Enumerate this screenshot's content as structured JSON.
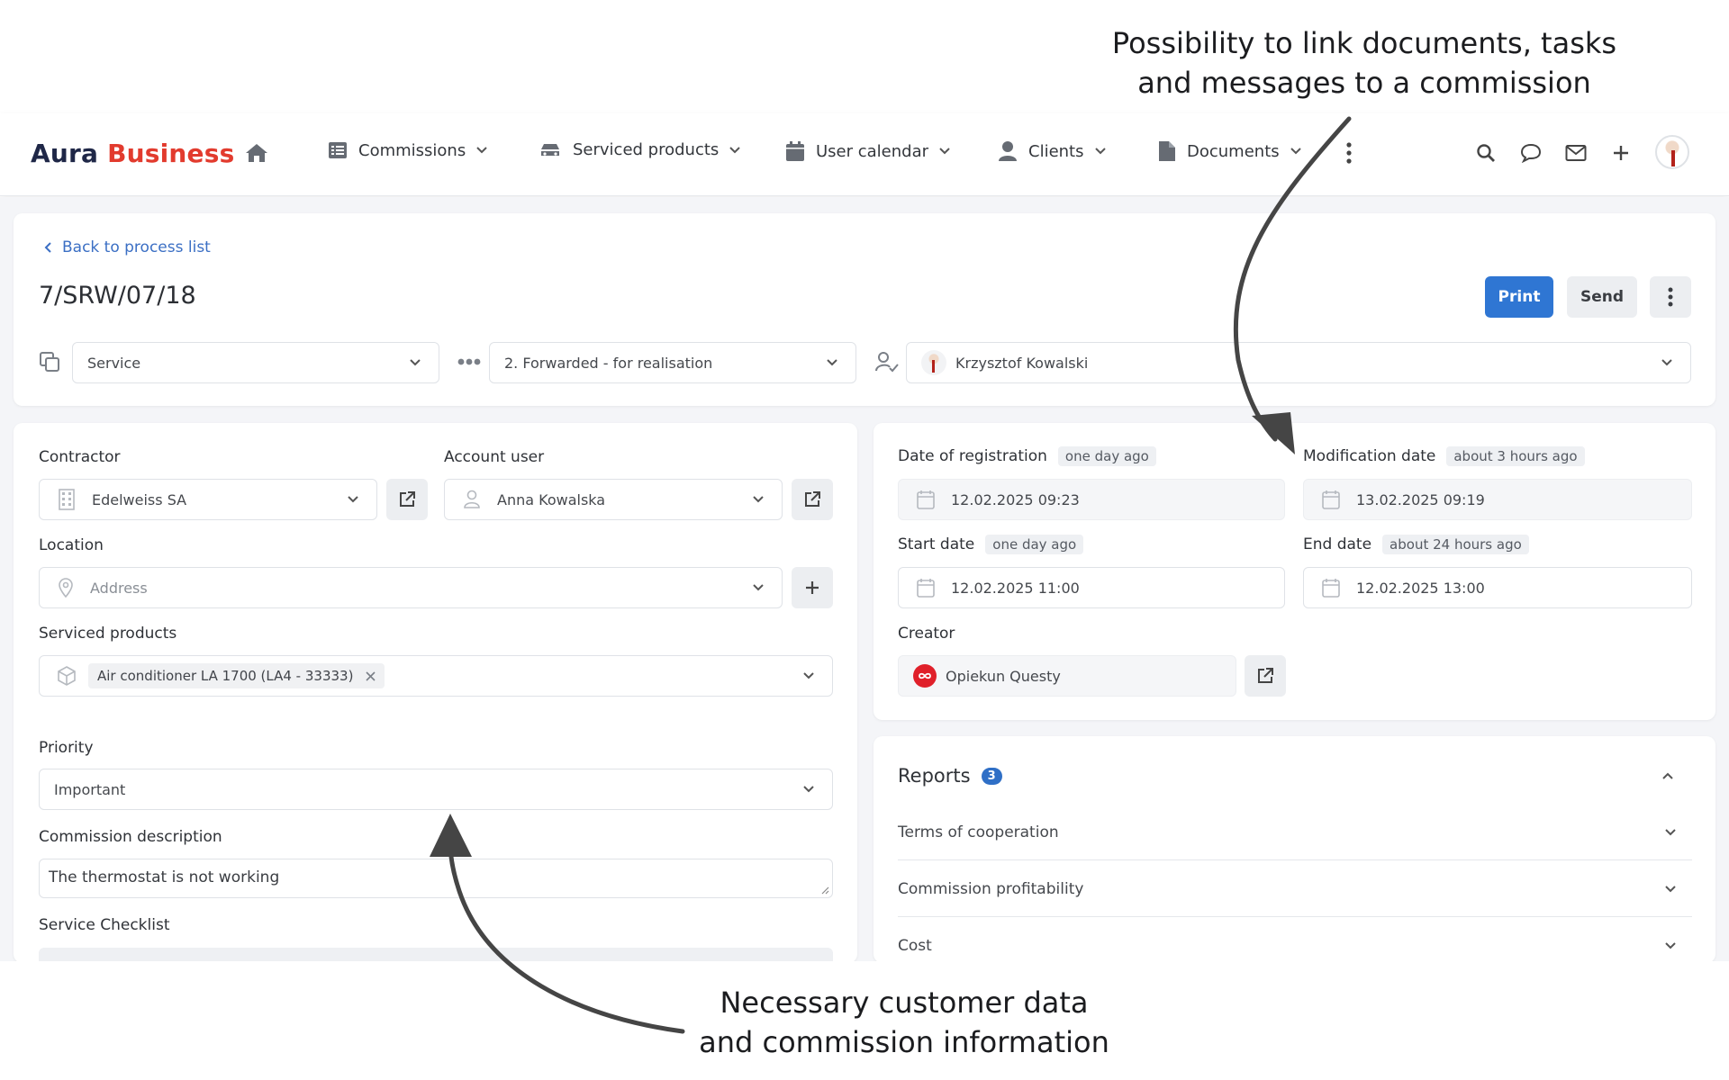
{
  "annotations": {
    "top_line1": "Possibility to link documents, tasks",
    "top_line2": "and messages to a commission",
    "bottom_line1": "Necessary customer data",
    "bottom_line2": "and commission information"
  },
  "navbar": {
    "logo_part1": "Aura",
    "logo_part2": "Business",
    "items": [
      {
        "label": "Commissions",
        "icon": "list-icon"
      },
      {
        "label": "Serviced products",
        "icon": "car-icon"
      },
      {
        "label": "User calendar",
        "icon": "calendar-icon"
      },
      {
        "label": "Clients",
        "icon": "user-icon"
      },
      {
        "label": "Documents",
        "icon": "document-icon"
      }
    ]
  },
  "header": {
    "back_label": "Back to process list",
    "title": "7/SRW/07/18",
    "print_label": "Print",
    "send_label": "Send",
    "type_value": "Service",
    "status_value": "2. Forwarded - for realisation",
    "assignee_value": "Krzysztof Kowalski"
  },
  "left": {
    "contractor_label": "Contractor",
    "contractor_value": "Edelweiss SA",
    "account_user_label": "Account user",
    "account_user_value": "Anna Kowalska",
    "location_label": "Location",
    "location_placeholder": "Address",
    "serviced_products_label": "Serviced products",
    "serviced_product_chip": "Air conditioner LA 1700 (LA4 - 33333)",
    "priority_label": "Priority",
    "priority_value": "Important",
    "description_label": "Commission description",
    "description_value": "The thermostat is not working",
    "checklist_label": "Service Checklist"
  },
  "dates": {
    "registration_label": "Date of registration",
    "registration_rel": "one day ago",
    "registration_value": "12.02.2025 09:23",
    "modification_label": "Modification date",
    "modification_rel": "about 3 hours ago",
    "modification_value": "13.02.2025 09:19",
    "start_label": "Start date",
    "start_rel": "one day ago",
    "start_value": "12.02.2025 11:00",
    "end_label": "End date",
    "end_rel": "about 24 hours ago",
    "end_value": "12.02.2025 13:00",
    "creator_label": "Creator",
    "creator_value": "Opiekun Questy"
  },
  "reports": {
    "title": "Reports",
    "count": "3",
    "rows": [
      {
        "label": "Terms of cooperation"
      },
      {
        "label": "Commission profitability"
      },
      {
        "label": "Cost"
      }
    ]
  },
  "colors": {
    "accent": "#2f76d3",
    "brand_dark": "#1f2747",
    "brand_red": "#e23b2e"
  }
}
